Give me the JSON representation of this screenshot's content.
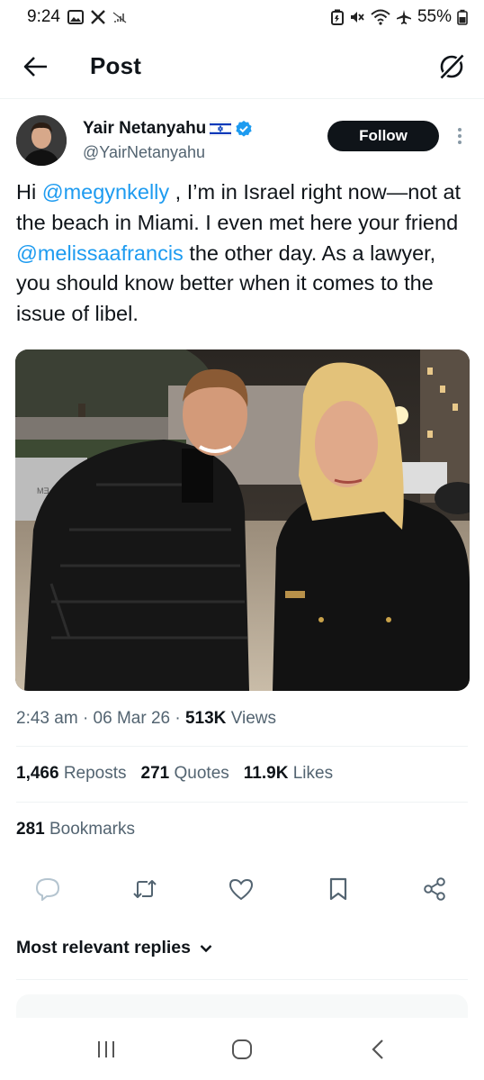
{
  "status_bar": {
    "time": "9:24",
    "battery": "55%",
    "left_icons": [
      "gallery-icon",
      "x-app-icon",
      "signal-off-icon"
    ],
    "right_icons": [
      "battery-saver-icon",
      "mute-icon",
      "wifi-icon",
      "airplane-icon",
      "battery-icon"
    ]
  },
  "header": {
    "title": "Post"
  },
  "author": {
    "name": "Yair Netanyahu",
    "flag": "🇮🇱",
    "handle": "@YairNetanyahu",
    "follow_label": "Follow"
  },
  "tweet": {
    "t1": "Hi ",
    "m1": "@megynkelly",
    "t2": " , I’m in Israel right now—not at the beach in Miami. I even met here your friend ",
    "m2": "@melissaafrancis",
    "t3": " the other day. As a lawyer, you should know better when it comes to the issue of libel."
  },
  "photo": {
    "sign_text": "JERUSALEM"
  },
  "meta": {
    "time": "2:43 am",
    "date": "06 Mar 26",
    "views_count": "513K",
    "views_label": "Views"
  },
  "stats": {
    "reposts_count": "1,466",
    "reposts_label": "Reposts",
    "quotes_count": "271",
    "quotes_label": "Quotes",
    "likes_count": "11.9K",
    "likes_label": "Likes",
    "bookmarks_count": "281",
    "bookmarks_label": "Bookmarks"
  },
  "replies": {
    "sort_label": "Most relevant replies"
  },
  "colors": {
    "accent": "#1d9bf0",
    "text": "#0f1419",
    "secondary": "#536471",
    "divider": "#eff3f4",
    "verified": "#1d9bf0"
  }
}
